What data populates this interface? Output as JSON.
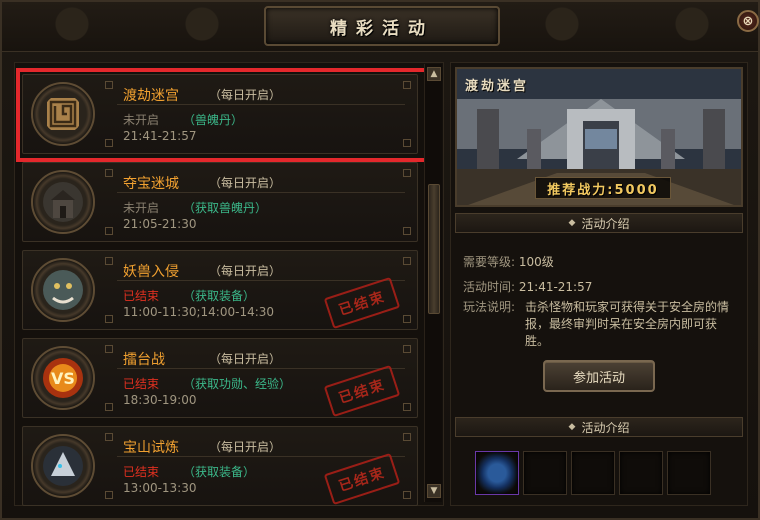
{
  "window": {
    "title": "精彩活动",
    "close_label": "⊗"
  },
  "activities": [
    {
      "name": "渡劫迷宫",
      "tag": "（每日开启）",
      "status": "未开启",
      "status_type": "pending",
      "reward": "（兽魄丹）",
      "time": "21:41-21:57",
      "icon": "maze-icon",
      "stamp": ""
    },
    {
      "name": "夺宝迷城",
      "tag": "（每日开启）",
      "status": "未开启",
      "status_type": "pending",
      "reward": "（获取兽魄丹）",
      "time": "21:05-21:30",
      "icon": "fortress-icon",
      "stamp": ""
    },
    {
      "name": "妖兽入侵",
      "tag": "（每日开启）",
      "status": "已结束",
      "status_type": "ended",
      "reward": "（获取装备）",
      "time": "11:00-11:30;14:00-14:30",
      "icon": "beast-face-icon",
      "stamp": "已结束"
    },
    {
      "name": "擂台战",
      "tag": "（每日开启）",
      "status": "已结束",
      "status_type": "ended",
      "reward": "（获取功勋、经验）",
      "time": "18:30-19:00",
      "icon": "versus-icon",
      "stamp": "已结束"
    },
    {
      "name": "宝山试炼",
      "tag": "（每日开启）",
      "status": "已结束",
      "status_type": "ended",
      "reward": "（获取装备）",
      "time": "13:00-13:30",
      "icon": "silver-beast-icon",
      "stamp": "已结束"
    }
  ],
  "detail": {
    "preview_title": "渡劫迷宫",
    "power_text": "推荐战力:5000",
    "section_intro_1": "活动介绍",
    "level_label": "需要等级:",
    "level_value": "100级",
    "time_label": "活动时间:",
    "time_value": "21:41-21:57",
    "desc_label": "玩法说明:",
    "desc_value": "击杀怪物和玩家可获得关于安全房的情报，最终审判时呆在安全房内即可获胜。",
    "join_button": "参加活动",
    "section_intro_2": "活动介绍"
  },
  "reward_slots": [
    "crystal-orb-icon",
    "",
    "",
    "",
    "",
    ""
  ],
  "colors": {
    "highlight": "#e4282c",
    "name": "#f0a030",
    "reward": "#3bb88a",
    "ended": "#e03020"
  }
}
